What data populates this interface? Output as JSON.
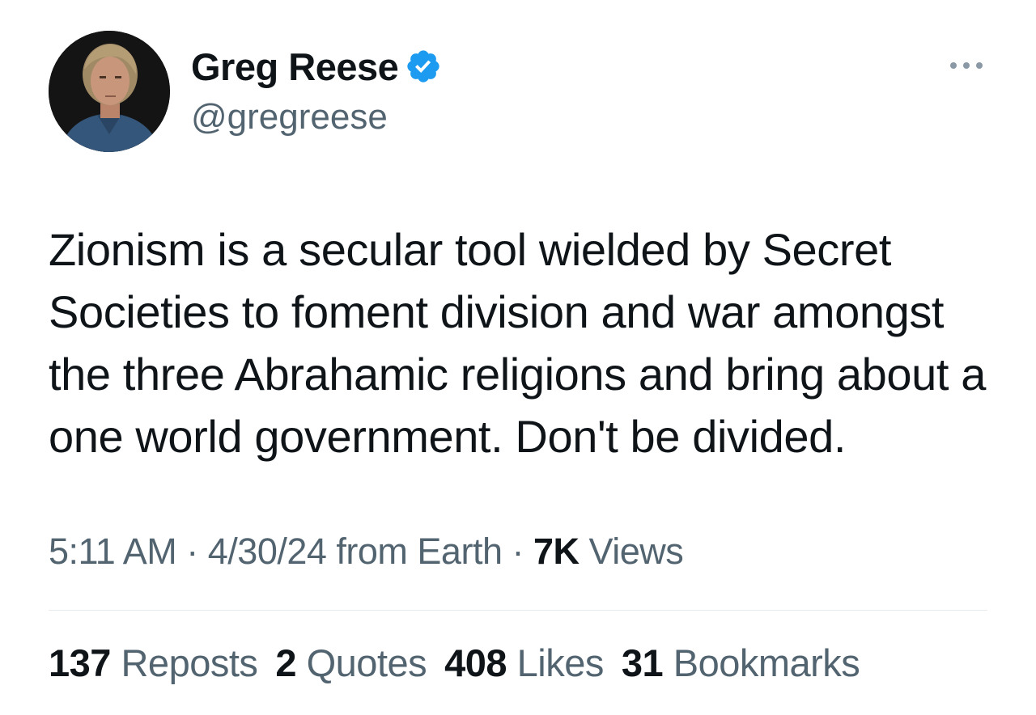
{
  "author": {
    "display_name": "Greg Reese",
    "handle": "@gregreese",
    "verified_color": "#1d9bf0",
    "avatar_icon": "profile-photo"
  },
  "more_icon": "ellipsis-icon",
  "tweet": {
    "text": "Zionism is a secular tool wielded by Secret Societies to foment division and war amongst the three Abrahamic religions and bring about a one world government. Don't be divided."
  },
  "meta": {
    "time": "5:11 AM",
    "sep1": " · ",
    "date": "4/30/24",
    "source": " from Earth",
    "sep2": " · ",
    "views_count": "7K",
    "views_label": " Views"
  },
  "stats": [
    {
      "count": "137",
      "label": "Reposts"
    },
    {
      "count": "2",
      "label": "Quotes"
    },
    {
      "count": "408",
      "label": "Likes"
    },
    {
      "count": "31",
      "label": "Bookmarks"
    }
  ],
  "colors": {
    "text_primary": "#0f1419",
    "text_secondary": "#536471",
    "divider": "#e6ecf0"
  }
}
